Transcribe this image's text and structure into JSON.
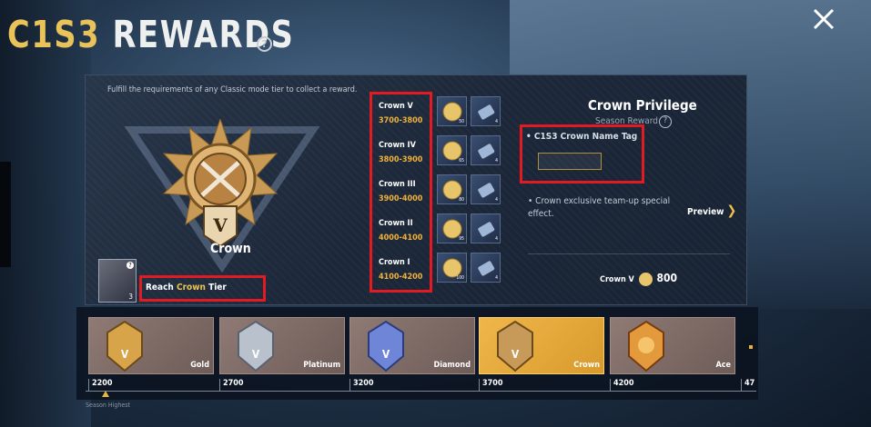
{
  "header": {
    "title_prefix": "C1S3",
    "title_suffix": "REWARDS",
    "help_icon": "?",
    "close_icon": "close-icon"
  },
  "panel": {
    "instructions": "Fulfill the requirements of any Classic mode tier to collect a reward.",
    "tier_name": "Crown",
    "item_count": "3",
    "reach_prefix": "Reach ",
    "reach_highlight": "Crown",
    "reach_suffix": " Tier"
  },
  "tiers": [
    {
      "name": "Crown V",
      "range": "3700-3800",
      "reward1_qty": "50",
      "reward2_qty": "4"
    },
    {
      "name": "Crown IV",
      "range": "3800-3900",
      "reward1_qty": "65",
      "reward2_qty": "4"
    },
    {
      "name": "Crown III",
      "range": "3900-4000",
      "reward1_qty": "80",
      "reward2_qty": "4"
    },
    {
      "name": "Crown II",
      "range": "4000-4100",
      "reward1_qty": "95",
      "reward2_qty": "4"
    },
    {
      "name": "Crown I",
      "range": "4100-4200",
      "reward1_qty": "100",
      "reward2_qty": "4"
    }
  ],
  "privilege": {
    "title": "Crown Privilege",
    "season_reward": "Season Reward",
    "name_tag_label": "• C1S3 Crown Name Tag",
    "effect": "• Crown exclusive team-up special effect.",
    "preview": "Preview",
    "price_label": "Crown V",
    "price_value": "800"
  },
  "ranks": [
    {
      "label": "Gold",
      "points": "2200",
      "active": false,
      "color": "#d7a44a"
    },
    {
      "label": "Platinum",
      "points": "2700",
      "active": false,
      "color": "#b9c2cc"
    },
    {
      "label": "Diamond",
      "points": "3200",
      "active": false,
      "color": "#6f86d8"
    },
    {
      "label": "Crown",
      "points": "3700",
      "active": true,
      "color": "#c89a5a"
    },
    {
      "label": "Ace",
      "points": "4200",
      "active": false,
      "color": "#e29a3c"
    },
    {
      "label": "",
      "points": "47",
      "active": false,
      "color": "#888"
    }
  ],
  "season_highest": "Season Highest",
  "colors": {
    "accent": "#f0b23a",
    "highlight_box": "#e21a22"
  }
}
